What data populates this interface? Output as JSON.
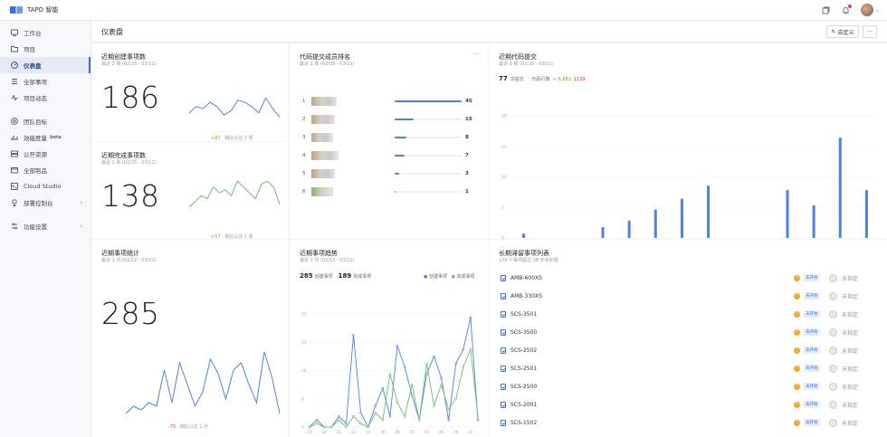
{
  "app": {
    "name": "TAPD 智能"
  },
  "topbar": {
    "icons": [
      "window-icon",
      "bell-icon",
      "avatar"
    ]
  },
  "sidebar": {
    "items": [
      {
        "label": "工作台",
        "icon": "desk-icon"
      },
      {
        "label": "项目",
        "icon": "folder-icon"
      },
      {
        "label": "仪表盘",
        "icon": "dashboard-icon",
        "active": true
      },
      {
        "label": "全部事项",
        "icon": "list-icon"
      },
      {
        "label": "项目动态",
        "icon": "activity-icon"
      },
      {
        "label": "团队目标",
        "icon": "target-icon"
      },
      {
        "label": "效能度量",
        "icon": "metrics-icon",
        "badge": "beta"
      },
      {
        "label": "公开资源",
        "icon": "resource-icon"
      },
      {
        "label": "全部制品",
        "icon": "artifact-icon"
      },
      {
        "label": "Cloud Studio",
        "icon": "cloud-icon"
      },
      {
        "label": "部署控制台",
        "icon": "deploy-icon",
        "arrow": true
      },
      {
        "label": "功能设置",
        "icon": "settings-icon",
        "arrow": true
      }
    ]
  },
  "header": {
    "title": "仪表盘",
    "custom_button": "自定义",
    "more_button": "···"
  },
  "cards": {
    "created": {
      "title": "近期创建事项数",
      "subtitle": "最近 2 周 (02/25 - 03/11)",
      "value": "186",
      "delta": "+87",
      "delta_label": "相比以往 2 周"
    },
    "completed": {
      "title": "近期完成事项数",
      "subtitle": "最近 2 周 (02/25 - 03/11)",
      "value": "138",
      "delta": "+57",
      "delta_label": "相比以往 2 周"
    },
    "stats": {
      "title": "近期事项统计",
      "subtitle": "最近 1 月 (02/12 - 03/11)",
      "value": "285",
      "delta": "-75",
      "delta_label": "相比以往 1 月"
    },
    "ranking": {
      "title": "代码提交成员排名",
      "subtitle": "最近 2 周 (02/25 - 03/11)",
      "more": "···",
      "rows": [
        {
          "rank": "1",
          "value": "45",
          "ratio": 1.0
        },
        {
          "rank": "2",
          "value": "15",
          "ratio": 0.29
        },
        {
          "rank": "3",
          "value": "8",
          "ratio": 0.18
        },
        {
          "rank": "4",
          "value": "7",
          "ratio": 0.15
        },
        {
          "rank": "5",
          "value": "3",
          "ratio": 0.07
        },
        {
          "rank": "6",
          "value": "1",
          "ratio": 0.02
        }
      ]
    },
    "commits": {
      "title": "近期代码提交",
      "subtitle": "最近 2 周 (02/25 - 03/11)",
      "count": "77",
      "count_label": "次提交",
      "lines_label": "代码行数",
      "added": "+ 6,881",
      "removed": "1159"
    },
    "trend": {
      "title": "近期事项趋势",
      "subtitle": "最近 1 月 (02/12 - 03/11)",
      "created_count": "285",
      "created_label": "创建事项",
      "done_count": "189",
      "done_label": "完成事项",
      "legend_created": "创建事项",
      "legend_done": "完成事项"
    },
    "stale": {
      "title": "长期滞留事项列表",
      "subtitle": "126 个事项超过 28 天未处理",
      "items": [
        {
          "id": "AMB-600XS",
          "state": "未开始",
          "assignee": "未指定"
        },
        {
          "id": "AMB-330XS",
          "state": "未开始",
          "assignee": "未指定"
        },
        {
          "id": "SCS-3501",
          "state": "未开始",
          "assignee": "未指定"
        },
        {
          "id": "SCS-3500",
          "state": "未开始",
          "assignee": "未指定"
        },
        {
          "id": "SCS-2502",
          "state": "未开始",
          "assignee": "未指定"
        },
        {
          "id": "SCS-2501",
          "state": "未开始",
          "assignee": "未指定"
        },
        {
          "id": "SCS-2500",
          "state": "未开始",
          "assignee": "未指定"
        },
        {
          "id": "SCS-2001",
          "state": "未开始",
          "assignee": "未指定"
        },
        {
          "id": "SCS-1502",
          "state": "未开始",
          "assignee": "未指定"
        }
      ]
    }
  },
  "colors": {
    "accent": "#3b6fe0",
    "line_blue": "#4f82e0",
    "line_green": "#6cc06c",
    "positive": "#52c41a",
    "negative": "#f5222d"
  },
  "chart_data": [
    {
      "type": "line",
      "title": "近期创建事项数",
      "values": [
        9,
        12,
        11,
        14,
        12,
        8,
        10,
        15,
        14,
        12,
        9,
        16,
        11,
        7
      ]
    },
    {
      "type": "line",
      "title": "近期完成事项数",
      "values": [
        4,
        6,
        8,
        7,
        11,
        9,
        10,
        8,
        13,
        11,
        9,
        7,
        12,
        13,
        11,
        5
      ]
    },
    {
      "type": "line",
      "title": "近期事项统计",
      "values": [
        0,
        2,
        1,
        3,
        2,
        12,
        3,
        14,
        8,
        2,
        6,
        15,
        11,
        4,
        12,
        14,
        8,
        3,
        17,
        10,
        0
      ]
    },
    {
      "type": "bar",
      "title": "近期代码提交",
      "categories": [
        "26",
        "27",
        "28",
        "01",
        "02",
        "03",
        "04",
        "05",
        "06",
        "07",
        "08",
        "09",
        "10",
        "11"
      ],
      "yticks": [
        "0",
        "7",
        "14",
        "21",
        "28"
      ],
      "ylim": [
        0,
        28
      ],
      "values": [
        1,
        0,
        0,
        2.5,
        4,
        6.5,
        9,
        12,
        0,
        0,
        11,
        7.5,
        23,
        11
      ]
    },
    {
      "type": "line",
      "title": "近期事项趋势",
      "x": [
        "16",
        "17",
        "18",
        "19",
        "20",
        "21",
        "22",
        "23",
        "24",
        "25",
        "26",
        "27",
        "28",
        "01",
        "02",
        "03",
        "04",
        "05",
        "06",
        "07",
        "08",
        "09",
        "10",
        "11"
      ],
      "yticks": [
        "0",
        "8",
        "16",
        "24",
        "32"
      ],
      "ylim": [
        0,
        32
      ],
      "series": [
        {
          "name": "创建事项",
          "values": [
            0,
            2,
            0,
            0,
            3,
            1,
            26,
            4,
            0,
            6,
            11,
            3,
            23,
            17,
            9,
            2,
            15,
            20,
            14,
            2,
            18,
            22,
            31,
            2
          ]
        },
        {
          "name": "完成事项",
          "values": [
            0,
            1,
            0,
            0,
            2,
            0,
            3,
            1,
            0,
            4,
            2,
            15,
            7,
            3,
            12,
            2,
            18,
            6,
            12,
            5,
            8,
            17,
            22,
            3
          ]
        }
      ]
    }
  ]
}
